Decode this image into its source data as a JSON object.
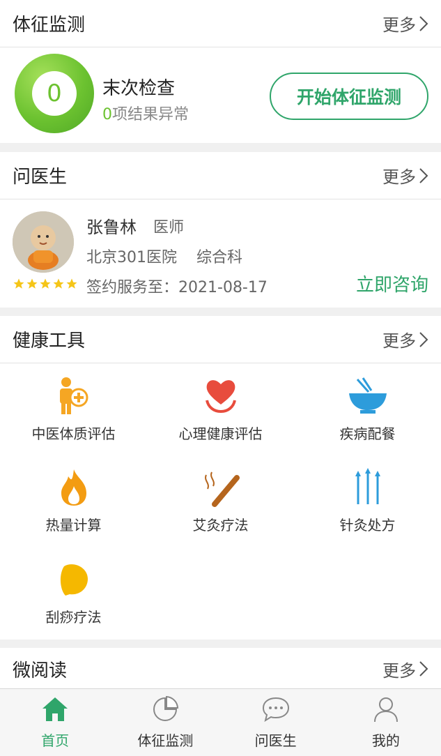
{
  "colors": {
    "accent": "#2fa56a",
    "ring": "#6cc230",
    "star": "#f5c518",
    "orange": "#f39c12",
    "red": "#e84c3d",
    "blue": "#2d9cdb"
  },
  "vitals": {
    "title": "体征监测",
    "more": "更多",
    "score": "0",
    "last_check": "末次检查",
    "abnormal_count": "0",
    "abnormal_text": "项结果异常",
    "start_button": "开始体征监测"
  },
  "doctor": {
    "title": "问医生",
    "more": "更多",
    "name": "张鲁林",
    "role": "医师",
    "hospital": "北京301医院",
    "department": "综合科",
    "sign_label": "签约服务至：",
    "sign_date": "2021-08-17",
    "rating": 5,
    "consult_button": "立即咨询"
  },
  "tools": {
    "title": "健康工具",
    "more": "更多",
    "items": [
      {
        "label": "中医体质评估",
        "icon": "tcm-constitution-icon"
      },
      {
        "label": "心理健康评估",
        "icon": "heart-hands-icon"
      },
      {
        "label": "疾病配餐",
        "icon": "bowl-chopsticks-icon"
      },
      {
        "label": "热量计算",
        "icon": "flame-icon"
      },
      {
        "label": "艾灸疗法",
        "icon": "moxa-stick-icon"
      },
      {
        "label": "针灸处方",
        "icon": "acupuncture-needles-icon"
      },
      {
        "label": "刮痧疗法",
        "icon": "gua-sha-board-icon"
      }
    ]
  },
  "reading": {
    "title": "微阅读",
    "more": "更多"
  },
  "nav": {
    "items": [
      {
        "label": "首页",
        "icon": "home-icon",
        "active": true
      },
      {
        "label": "体征监测",
        "icon": "pie-chart-icon",
        "active": false
      },
      {
        "label": "问医生",
        "icon": "chat-bubble-icon",
        "active": false
      },
      {
        "label": "我的",
        "icon": "user-icon",
        "active": false
      }
    ]
  }
}
